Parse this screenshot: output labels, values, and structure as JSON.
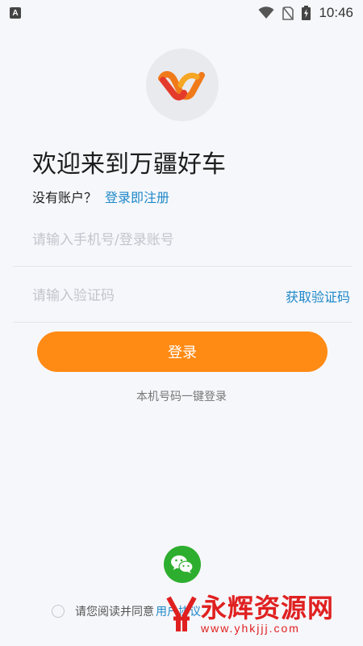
{
  "status_bar": {
    "time": "10:46",
    "left_icon_letter": "A",
    "icons": [
      "notification-a-icon",
      "wifi-icon",
      "no-sim-icon",
      "battery-charging-icon"
    ]
  },
  "app": {
    "welcome": "欢迎来到万疆好车",
    "no_account": "没有账户？",
    "register_link": "登录即注册"
  },
  "form": {
    "phone_placeholder": "请输入手机号/登录账号",
    "code_placeholder": "请输入验证码",
    "get_code_label": "获取验证码",
    "login_label": "登录",
    "one_click_login": "本机号码一键登录"
  },
  "footer": {
    "agree_prefix": "请您阅读并同意",
    "agreement_link": "用户协议"
  },
  "watermark": {
    "title": "永辉资源网",
    "url": "www.yhkjjj.com"
  },
  "colors": {
    "accent": "#ff8a14",
    "link": "#1e88c8",
    "wechat": "#2eae2e",
    "background": "#f6f7fb"
  }
}
